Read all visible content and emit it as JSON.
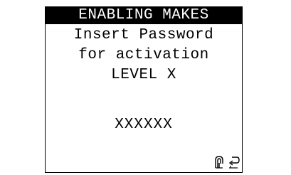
{
  "header": {
    "title": "ENABLING MAKES"
  },
  "body": {
    "line1": "Insert Password",
    "line2": "for activation",
    "line3": "LEVEL X",
    "password": "XXXXXX"
  },
  "icons": {
    "left": "enter-icon",
    "right": "back-arrow-icon"
  },
  "colors": {
    "background": "#ffffff",
    "text": "#000000",
    "title_background": "#000000",
    "title_text": "#ffffff"
  }
}
